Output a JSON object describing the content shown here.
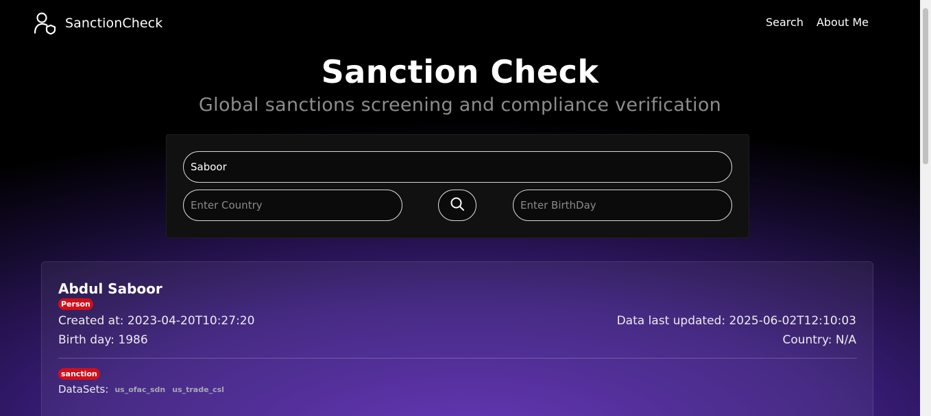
{
  "brand": {
    "name": "SanctionCheck",
    "icon": "user-shield-icon"
  },
  "nav": {
    "items": [
      {
        "label": "Search"
      },
      {
        "label": "About Me"
      }
    ]
  },
  "hero": {
    "title": "Sanction Check",
    "subtitle": "Global sanctions screening and compliance verification"
  },
  "search": {
    "name_value": "Saboor",
    "country_placeholder": "Enter Country",
    "birthday_placeholder": "Enter BirthDay",
    "button_icon": "search-icon"
  },
  "result": {
    "name": "Abdul Saboor",
    "type_badge": "Person",
    "created": "Created at: 2023-04-20T10:27:20",
    "birthday": "Birth day: 1986",
    "updated": "Data last updated: 2025-06-02T12:10:03",
    "country": "Country: N/A",
    "topic_badge": "sanction",
    "datasets_label": "DataSets:",
    "datasets": [
      "us_ofac_sdn",
      "us_trade_csl"
    ]
  },
  "colors": {
    "badge": "#d10f1b",
    "accent_purple": "#5a2bb0",
    "background": "#000000"
  }
}
